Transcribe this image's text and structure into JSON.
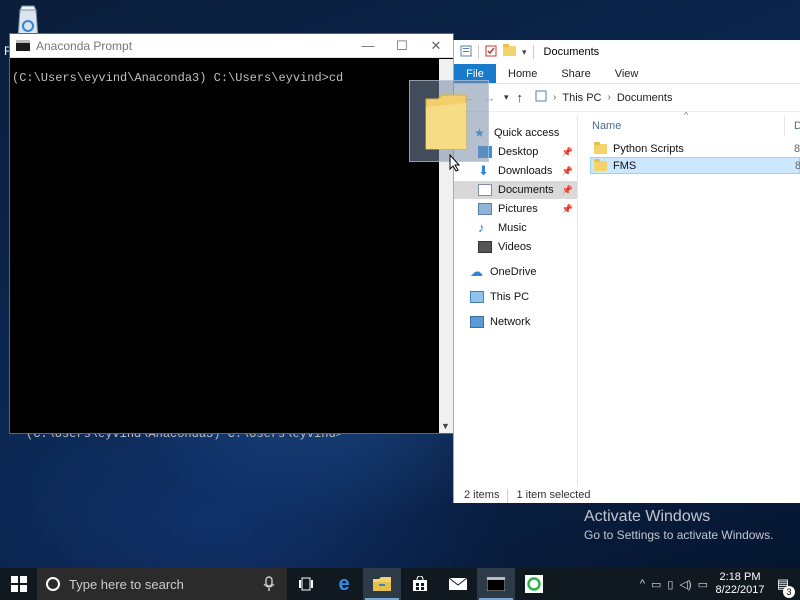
{
  "desktop": {
    "recycle_bin_label": "R",
    "background_console_text": "(C:\\Users\\eyvind\\Anaconda3) C:\\Users\\eyvind>"
  },
  "cmd_window": {
    "title": "Anaconda Prompt",
    "line": "(C:\\Users\\eyvind\\Anaconda3) C:\\Users\\eyvind>cd",
    "minimize": "—",
    "maximize": "☐",
    "close": "✕"
  },
  "explorer": {
    "title": "Documents",
    "ribbon_tabs": [
      "File",
      "Home",
      "Share",
      "View"
    ],
    "breadcrumb": [
      "This PC",
      "Documents"
    ],
    "nav": {
      "quick_access": "Quick access",
      "items": [
        "Desktop",
        "Downloads",
        "Documents",
        "Pictures",
        "Music",
        "Videos"
      ],
      "onedrive": "OneDrive",
      "this_pc": "This PC",
      "network": "Network"
    },
    "columns": {
      "name": "Name",
      "date": "D"
    },
    "files": [
      {
        "name": "Python Scripts",
        "date": "8,"
      },
      {
        "name": "FMS",
        "date": "8,"
      }
    ],
    "selected_file": "FMS",
    "status": {
      "count": "2 items",
      "selected": "1 item selected"
    }
  },
  "watermark": {
    "title": "Activate Windows",
    "subtitle": "Go to Settings to activate Windows."
  },
  "taskbar": {
    "search_placeholder": "Type here to search",
    "clock_time": "2:18 PM",
    "clock_date": "8/22/2017",
    "notification_count": "3"
  },
  "colors": {
    "accent": "#1979ca",
    "selection": "#cce8ff",
    "folder": "#f5d36b"
  }
}
